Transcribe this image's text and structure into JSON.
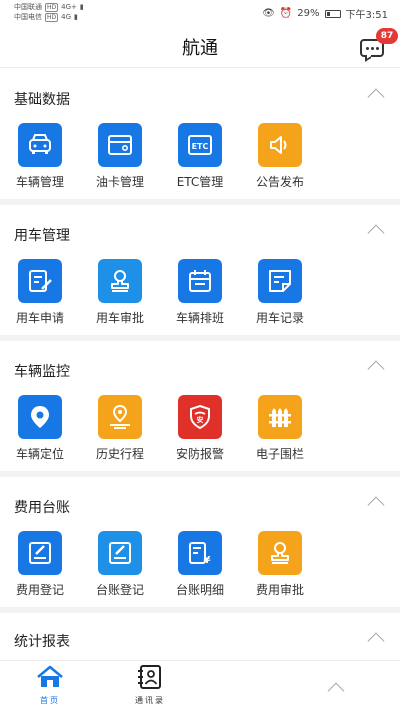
{
  "status_bar": {
    "carrier1": "中国联通",
    "carrier2": "中国电信",
    "hd": "HD",
    "net1": "4G+",
    "net2": "4G",
    "battery": "29%",
    "battery_level": 0.29,
    "time": "下午3:51"
  },
  "header": {
    "title": "航通",
    "message_badge": "87"
  },
  "sections": [
    {
      "title": "基础数据",
      "items": [
        {
          "label": "车辆管理",
          "icon": "car-icon",
          "color": "#1677e5"
        },
        {
          "label": "油卡管理",
          "icon": "card-icon",
          "color": "#1677e5"
        },
        {
          "label": "ETC管理",
          "icon": "etc-icon",
          "color": "#1677e5"
        },
        {
          "label": "公告发布",
          "icon": "speaker-icon",
          "color": "#f5a31a"
        }
      ]
    },
    {
      "title": "用车管理",
      "items": [
        {
          "label": "用车申请",
          "icon": "edit-doc-icon",
          "color": "#1677e5"
        },
        {
          "label": "用车审批",
          "icon": "stamp-icon",
          "color": "#1e90e8"
        },
        {
          "label": "车辆排班",
          "icon": "calendar-icon",
          "color": "#1677e5"
        },
        {
          "label": "用车记录",
          "icon": "note-icon",
          "color": "#1677e5"
        }
      ]
    },
    {
      "title": "车辆监控",
      "items": [
        {
          "label": "车辆定位",
          "icon": "location-pin-icon",
          "color": "#1677e5"
        },
        {
          "label": "历史行程",
          "icon": "route-icon",
          "color": "#f5a31a"
        },
        {
          "label": "安防报警",
          "icon": "shield-alarm-icon",
          "color": "#e0302a"
        },
        {
          "label": "电子围栏",
          "icon": "fence-icon",
          "color": "#f5a31a"
        }
      ]
    },
    {
      "title": "费用台账",
      "items": [
        {
          "label": "费用登记",
          "icon": "register-icon",
          "color": "#1677e5"
        },
        {
          "label": "台账登记",
          "icon": "ledger-edit-icon",
          "color": "#1e90e8"
        },
        {
          "label": "台账明细",
          "icon": "yuan-doc-icon",
          "color": "#1677e5"
        },
        {
          "label": "费用审批",
          "icon": "stamp-icon",
          "color": "#f5a31a"
        }
      ]
    }
  ],
  "last_section": {
    "title": "统计报表"
  },
  "bottom_nav": {
    "home_label": "首页",
    "contacts_label": "通讯录"
  }
}
